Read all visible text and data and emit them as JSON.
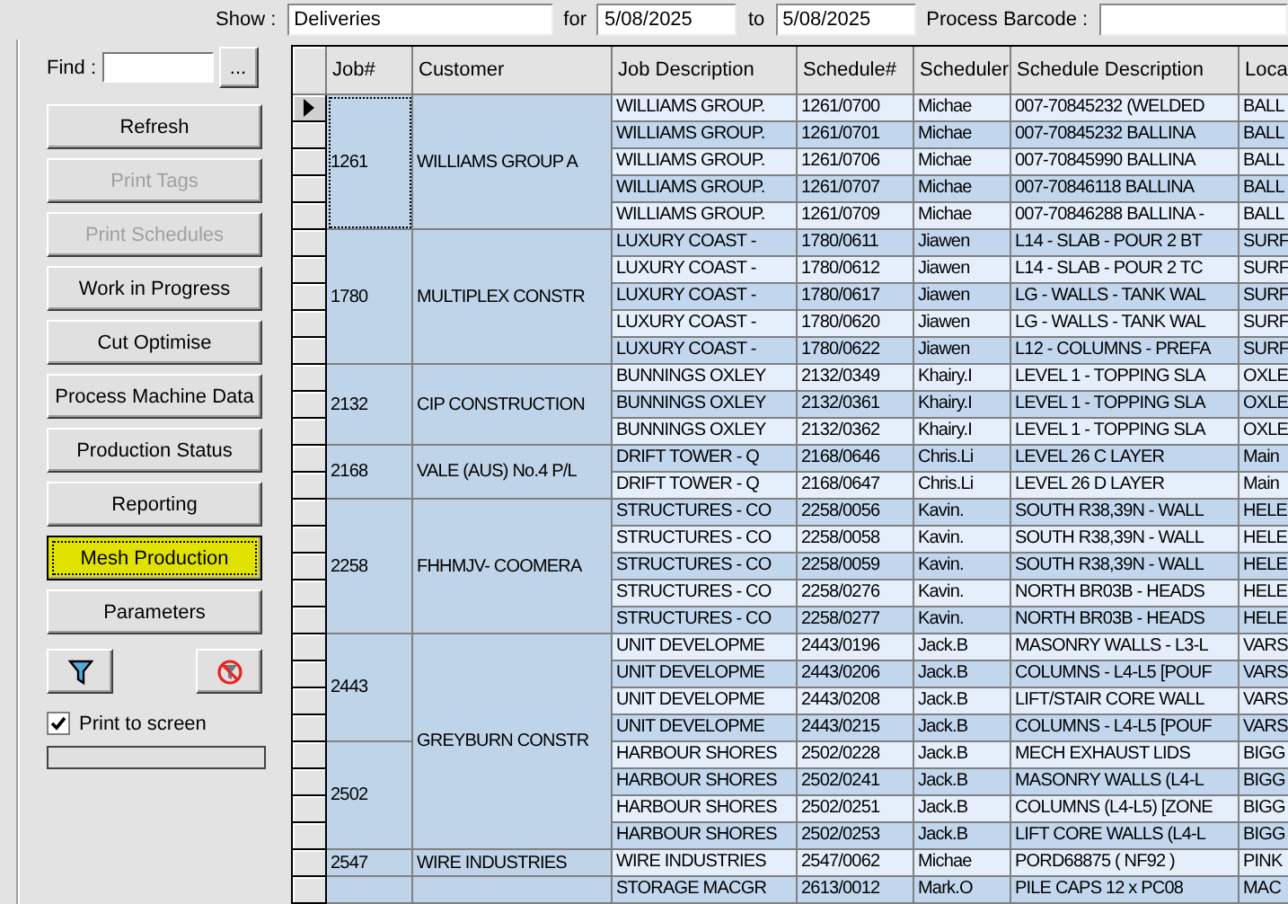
{
  "top_bar": {
    "show_label": "Show :",
    "show_value": "Deliveries",
    "for_label": "for",
    "from_date": "5/08/2025",
    "to_label": "to",
    "to_date": "5/08/2025",
    "barcode_label": "Process Barcode :"
  },
  "find": {
    "label": "Find :",
    "browse": "..."
  },
  "buttons": [
    {
      "label": "Refresh",
      "disabled": false,
      "highlighted": false
    },
    {
      "label": "Print Tags",
      "disabled": true,
      "highlighted": false
    },
    {
      "label": "Print Schedules",
      "disabled": true,
      "highlighted": false
    },
    {
      "label": "Work in Progress",
      "disabled": false,
      "highlighted": false
    },
    {
      "label": "Cut Optimise",
      "disabled": false,
      "highlighted": false
    },
    {
      "label": "Process Machine Data",
      "disabled": false,
      "highlighted": false
    },
    {
      "label": "Production Status",
      "disabled": false,
      "highlighted": false
    },
    {
      "label": "Reporting",
      "disabled": false,
      "highlighted": false
    },
    {
      "label": "Mesh Production",
      "disabled": false,
      "highlighted": true
    },
    {
      "label": "Parameters",
      "disabled": false,
      "highlighted": false
    }
  ],
  "print_to_screen": {
    "label": "Print to screen",
    "checked": true
  },
  "progress": {
    "level": 0
  },
  "table": {
    "columns": [
      "Job#",
      "Customer",
      "Job Description",
      "Schedule#",
      "Scheduler",
      "Schedule Description",
      "Loca"
    ],
    "customers": [
      {
        "customer": "WILLIAMS GROUP A",
        "jobs": [
          {
            "job": "1261",
            "selected": true,
            "schedules": [
              {
                "job_description": "WILLIAMS GROUP.",
                "schedule": "1261/0700",
                "scheduler": "Michae",
                "description": "007-70845232 (WELDED",
                "location": "BALL",
                "selected": true
              },
              {
                "job_description": "WILLIAMS GROUP.",
                "schedule": "1261/0701",
                "scheduler": "Michae",
                "description": "007-70845232 BALLINA",
                "location": "BALL",
                "selected": false
              },
              {
                "job_description": "WILLIAMS GROUP.",
                "schedule": "1261/0706",
                "scheduler": "Michae",
                "description": "007-70845990 BALLINA",
                "location": "BALL",
                "selected": false
              },
              {
                "job_description": "WILLIAMS GROUP.",
                "schedule": "1261/0707",
                "scheduler": "Michae",
                "description": "007-70846118 BALLINA",
                "location": "BALL",
                "selected": false
              },
              {
                "job_description": "WILLIAMS GROUP.",
                "schedule": "1261/0709",
                "scheduler": "Michae",
                "description": "007-70846288 BALLINA -",
                "location": "BALL",
                "selected": false
              }
            ]
          }
        ]
      },
      {
        "customer": "MULTIPLEX CONSTR",
        "jobs": [
          {
            "job": "1780",
            "selected": false,
            "schedules": [
              {
                "job_description": "LUXURY COAST -",
                "schedule": "1780/0611",
                "scheduler": "Jiawen",
                "description": "L14 - SLAB - POUR 2  BT",
                "location": "SURF",
                "selected": false
              },
              {
                "job_description": "LUXURY COAST -",
                "schedule": "1780/0612",
                "scheduler": "Jiawen",
                "description": "L14 - SLAB - POUR 2  TC",
                "location": "SURF",
                "selected": false
              },
              {
                "job_description": "LUXURY COAST -",
                "schedule": "1780/0617",
                "scheduler": "Jiawen",
                "description": "LG - WALLS - TANK WAL",
                "location": "SURF",
                "selected": false
              },
              {
                "job_description": "LUXURY COAST -",
                "schedule": "1780/0620",
                "scheduler": "Jiawen",
                "description": "LG - WALLS - TANK WAL",
                "location": "SURF",
                "selected": false
              },
              {
                "job_description": "LUXURY COAST -",
                "schedule": "1780/0622",
                "scheduler": "Jiawen",
                "description": "L12 - COLUMNS - PREFA",
                "location": "SURF",
                "selected": false
              }
            ]
          }
        ]
      },
      {
        "customer": "CIP CONSTRUCTION",
        "jobs": [
          {
            "job": "2132",
            "selected": false,
            "schedules": [
              {
                "job_description": "BUNNINGS OXLEY",
                "schedule": "2132/0349",
                "scheduler": "Khairy.I",
                "description": "LEVEL 1 - TOPPING SLA",
                "location": "OXLE",
                "selected": false
              },
              {
                "job_description": "BUNNINGS OXLEY",
                "schedule": "2132/0361",
                "scheduler": "Khairy.I",
                "description": "LEVEL 1 - TOPPING SLA",
                "location": "OXLE",
                "selected": false
              },
              {
                "job_description": "BUNNINGS OXLEY",
                "schedule": "2132/0362",
                "scheduler": "Khairy.I",
                "description": "LEVEL 1 - TOPPING SLA",
                "location": "OXLE",
                "selected": false
              }
            ]
          }
        ]
      },
      {
        "customer": "VALE (AUS) No.4 P/L",
        "jobs": [
          {
            "job": "2168",
            "selected": false,
            "schedules": [
              {
                "job_description": "DRIFT TOWER - Q",
                "schedule": "2168/0646",
                "scheduler": "Chris.Li",
                "description": "LEVEL 26 C LAYER",
                "location": "Main",
                "selected": false
              },
              {
                "job_description": "DRIFT TOWER - Q",
                "schedule": "2168/0647",
                "scheduler": "Chris.Li",
                "description": "LEVEL 26 D LAYER",
                "location": "Main",
                "selected": false
              }
            ]
          }
        ]
      },
      {
        "customer": "FHHMJV- COOMERA",
        "jobs": [
          {
            "job": "2258",
            "selected": false,
            "schedules": [
              {
                "job_description": "STRUCTURES - CO",
                "schedule": "2258/0056",
                "scheduler": "Kavin.",
                "description": "SOUTH R38,39N - WALL",
                "location": "HELE",
                "selected": false
              },
              {
                "job_description": "STRUCTURES - CO",
                "schedule": "2258/0058",
                "scheduler": "Kavin.",
                "description": "SOUTH R38,39N - WALL",
                "location": "HELE",
                "selected": false
              },
              {
                "job_description": "STRUCTURES - CO",
                "schedule": "2258/0059",
                "scheduler": "Kavin.",
                "description": "SOUTH R38,39N - WALL",
                "location": "HELE",
                "selected": false
              },
              {
                "job_description": "STRUCTURES - CO",
                "schedule": "2258/0276",
                "scheduler": "Kavin.",
                "description": "NORTH BR03B - HEADS",
                "location": "HELE",
                "selected": false
              },
              {
                "job_description": "STRUCTURES - CO",
                "schedule": "2258/0277",
                "scheduler": "Kavin.",
                "description": "NORTH BR03B - HEADS",
                "location": "HELE",
                "selected": false
              }
            ]
          }
        ]
      },
      {
        "customer": "GREYBURN CONSTR",
        "jobs": [
          {
            "job": "2443",
            "selected": false,
            "schedules": [
              {
                "job_description": "UNIT DEVELOPME",
                "schedule": "2443/0196",
                "scheduler": "Jack.B",
                "description": "MASONRY WALLS - L3-L",
                "location": "VARS",
                "selected": false
              },
              {
                "job_description": "UNIT DEVELOPME",
                "schedule": "2443/0206",
                "scheduler": "Jack.B",
                "description": "COLUMNS - L4-L5 [POUF",
                "location": "VARS",
                "selected": false
              },
              {
                "job_description": "UNIT DEVELOPME",
                "schedule": "2443/0208",
                "scheduler": "Jack.B",
                "description": "LIFT/STAIR CORE WALL",
                "location": "VARS",
                "selected": false
              },
              {
                "job_description": "UNIT DEVELOPME",
                "schedule": "2443/0215",
                "scheduler": "Jack.B",
                "description": "COLUMNS - L4-L5 [POUF",
                "location": "VARS",
                "selected": false
              }
            ]
          },
          {
            "job": "2502",
            "selected": false,
            "schedules": [
              {
                "job_description": "HARBOUR SHORES",
                "schedule": "2502/0228",
                "scheduler": "Jack.B",
                "description": "MECH EXHAUST LIDS",
                "location": "BIGG",
                "selected": false
              },
              {
                "job_description": "HARBOUR SHORES",
                "schedule": "2502/0241",
                "scheduler": "Jack.B",
                "description": "MASONRY WALLS (L4-L",
                "location": "BIGG",
                "selected": false
              },
              {
                "job_description": "HARBOUR SHORES",
                "schedule": "2502/0251",
                "scheduler": "Jack.B",
                "description": "COLUMNS (L4-L5) [ZONE",
                "location": "BIGG",
                "selected": false
              },
              {
                "job_description": "HARBOUR SHORES",
                "schedule": "2502/0253",
                "scheduler": "Jack.B",
                "description": "LIFT CORE WALLS (L4-L",
                "location": "BIGG",
                "selected": false
              }
            ]
          }
        ]
      },
      {
        "customer": "WIRE INDUSTRIES",
        "jobs": [
          {
            "job": "2547",
            "selected": false,
            "schedules": [
              {
                "job_description": "WIRE INDUSTRIES",
                "schedule": "2547/0062",
                "scheduler": "Michae",
                "description": "PORD68875 ( NF92 )",
                "location": "PINK",
                "selected": false
              }
            ]
          }
        ]
      },
      {
        "jobs": [
          {
            "selected": false,
            "schedules": [
              {
                "job_description": "STORAGE MACGR",
                "schedule": "2613/0012",
                "scheduler": "Mark.O",
                "description": "PILE CAPS 12 x PC08",
                "location": "MAC",
                "selected": false
              }
            ]
          }
        ]
      }
    ]
  }
}
